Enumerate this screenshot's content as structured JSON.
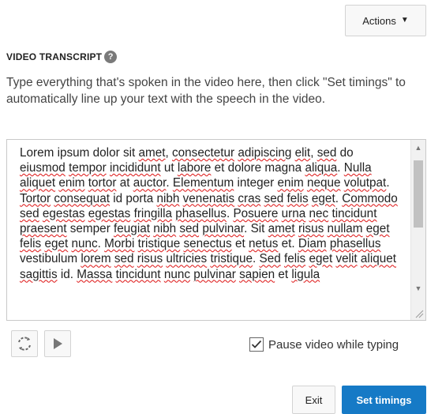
{
  "toolbar": {
    "actions_label": "Actions"
  },
  "transcript": {
    "title": "VIDEO TRANSCRIPT",
    "instructions": "Type everything that's spoken in the video here, then click \"Set timings\" to automatically line up your text with the speech in the video.",
    "text": "Lorem ipsum dolor sit amet, consectetur adipiscing elit, sed do eiusmod tempor incididunt ut labore et dolore magna aliqua. Nulla aliquet enim tortor at auctor. Elementum integer enim neque volutpat. Tortor consequat id porta nibh venenatis cras sed felis eget. Commodo sed egestas egestas fringilla phasellus. Posuere urna nec tincidunt praesent semper feugiat nibh sed pulvinar. Sit amet risus nullam eget felis eget nunc. Morbi tristique senectus et netus et. Diam phasellus vestibulum lorem sed risus ultricies tristique. Sed felis eget velit aliquet sagittis id. Massa tincidunt nunc pulvinar sapien et ligula",
    "misspelled": [
      "amet",
      "consectetur",
      "adipiscing",
      "elit",
      "sed",
      "eiusmod",
      "tempor",
      "incididunt",
      "labore",
      "aliqua",
      "Nulla",
      "aliquet",
      "enim",
      "tortor",
      "auctor",
      "Elementum",
      "neque",
      "volutpat",
      "Tortor",
      "consequat",
      "nibh",
      "venenatis",
      "cras",
      "felis",
      "eget",
      "Commodo",
      "egestas",
      "fringilla",
      "phasellus",
      "Posuere",
      "urna",
      "nec",
      "tincidunt",
      "praesent",
      "feugiat",
      "amet",
      "risus",
      "nullam",
      "nunc",
      "Morbi",
      "tristique",
      "senectus",
      "netus",
      "Diam",
      "lorem",
      "ultricies",
      "Sed",
      "velit",
      "sagittis",
      "Massa",
      "pulvinar",
      "sapien",
      "ligula"
    ]
  },
  "playback": {
    "pause_label": "Pause video while typing",
    "pause_checked": true
  },
  "footer": {
    "exit_label": "Exit",
    "set_timings_label": "Set timings"
  },
  "colors": {
    "primary": "#167ac6",
    "spellcheck": "#dd1111"
  },
  "icons": {
    "help": "help-icon",
    "sync": "sync-icon",
    "play": "play-icon",
    "check": "check-icon"
  }
}
